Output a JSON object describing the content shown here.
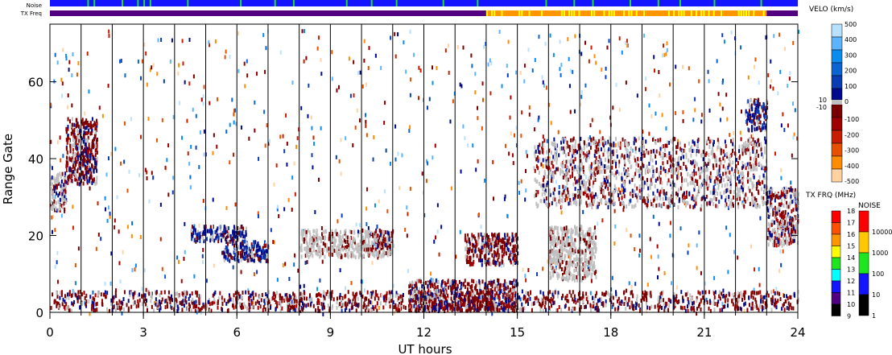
{
  "chart_data": {
    "type": "heatmap",
    "title": "",
    "xlabel": "UT hours",
    "ylabel": "Range Gate",
    "xlim": [
      0,
      24
    ],
    "ylim": [
      0,
      75
    ],
    "x_ticks": [
      "0",
      "3",
      "6",
      "9",
      "12",
      "15",
      "18",
      "21",
      "24"
    ],
    "y_ticks": [
      "0",
      "20",
      "40",
      "60"
    ],
    "top_bars": {
      "noise_label": "Noise",
      "txfreq_label": "TX Freq"
    },
    "txfreq_segments": [
      {
        "from": 0,
        "to": 14,
        "mhz": 10
      },
      {
        "from": 14,
        "to": 23,
        "mhz": 15
      },
      {
        "from": 23,
        "to": 24,
        "mhz": 10
      }
    ],
    "noise_green_times": [
      1.2,
      1.4,
      2.3,
      2.8,
      3.0,
      3.2,
      4.4,
      6.1,
      7.2,
      7.8,
      9.5,
      10.3,
      11.1,
      12.6,
      13.7,
      15.9,
      16.8,
      17.4,
      18.6,
      19.5,
      20.2,
      21.3,
      22.8
    ],
    "velocity_colorbar": {
      "title": "VELO (km/s)",
      "ticks": [
        "500",
        "400",
        "300",
        "200",
        "100",
        "0",
        "-100",
        "-200",
        "-300",
        "-400",
        "-500"
      ],
      "ground_labels": [
        "10",
        "-10"
      ],
      "colors": [
        "#b8e0ff",
        "#5ab4ff",
        "#0a8cf0",
        "#0a64d2",
        "#0a3cb4",
        "#000a8c",
        "#7a0000",
        "#a00000",
        "#c81e00",
        "#e65000",
        "#ff8c00",
        "#ffd2a0"
      ],
      "ground_color": "#c0c0c0"
    },
    "txfreq_colorbar": {
      "title": "TX FRQ (MHz)",
      "ticks": [
        "18",
        "17",
        "16",
        "15",
        "14",
        "13",
        "12",
        "11",
        "10",
        "9"
      ],
      "colors": [
        "#ff0000",
        "#ff5000",
        "#ff9600",
        "#ffff00",
        "#1ee61e",
        "#00ffff",
        "#1414ff",
        "#500080",
        "#000000"
      ]
    },
    "noise_colorbar": {
      "title": "NOISE",
      "ticks": [
        "10000",
        "1000",
        "100",
        "10",
        "1"
      ],
      "colors": [
        "#ff0000",
        "#ffc800",
        "#1ee61e",
        "#1414ff",
        "#000000"
      ]
    },
    "echo_regions": [
      {
        "t": [
          0,
          0.5
        ],
        "g": [
          26,
          36
        ],
        "v": "ground_mix"
      },
      {
        "t": [
          0.5,
          1.5
        ],
        "g": [
          33,
          50
        ],
        "v": "neg_low"
      },
      {
        "t": [
          4.5,
          6.3
        ],
        "g": [
          18,
          22
        ],
        "v": "pos_low"
      },
      {
        "t": [
          5.5,
          7
        ],
        "g": [
          13,
          18
        ],
        "v": "pos_low"
      },
      {
        "t": [
          8,
          11
        ],
        "g": [
          14,
          21
        ],
        "v": "ground"
      },
      {
        "t": [
          10.4,
          11
        ],
        "g": [
          16,
          21
        ],
        "v": "neg_low"
      },
      {
        "t": [
          13.3,
          15
        ],
        "g": [
          12,
          20
        ],
        "v": "neg_low"
      },
      {
        "t": [
          15.5,
          23
        ],
        "g": [
          27,
          45
        ],
        "v": "ground_mix"
      },
      {
        "t": [
          16,
          17.5
        ],
        "g": [
          8,
          22
        ],
        "v": "ground"
      },
      {
        "t": [
          23,
          24
        ],
        "g": [
          17,
          32
        ],
        "v": "ground_mix"
      },
      {
        "t": [
          22.3,
          23
        ],
        "g": [
          47,
          55
        ],
        "v": "pos_low"
      },
      {
        "t": [
          0,
          24
        ],
        "g": [
          0,
          5
        ],
        "v": "neg_pos"
      },
      {
        "t": [
          11.5,
          15
        ],
        "g": [
          0,
          8
        ],
        "v": "neg_low"
      }
    ]
  }
}
